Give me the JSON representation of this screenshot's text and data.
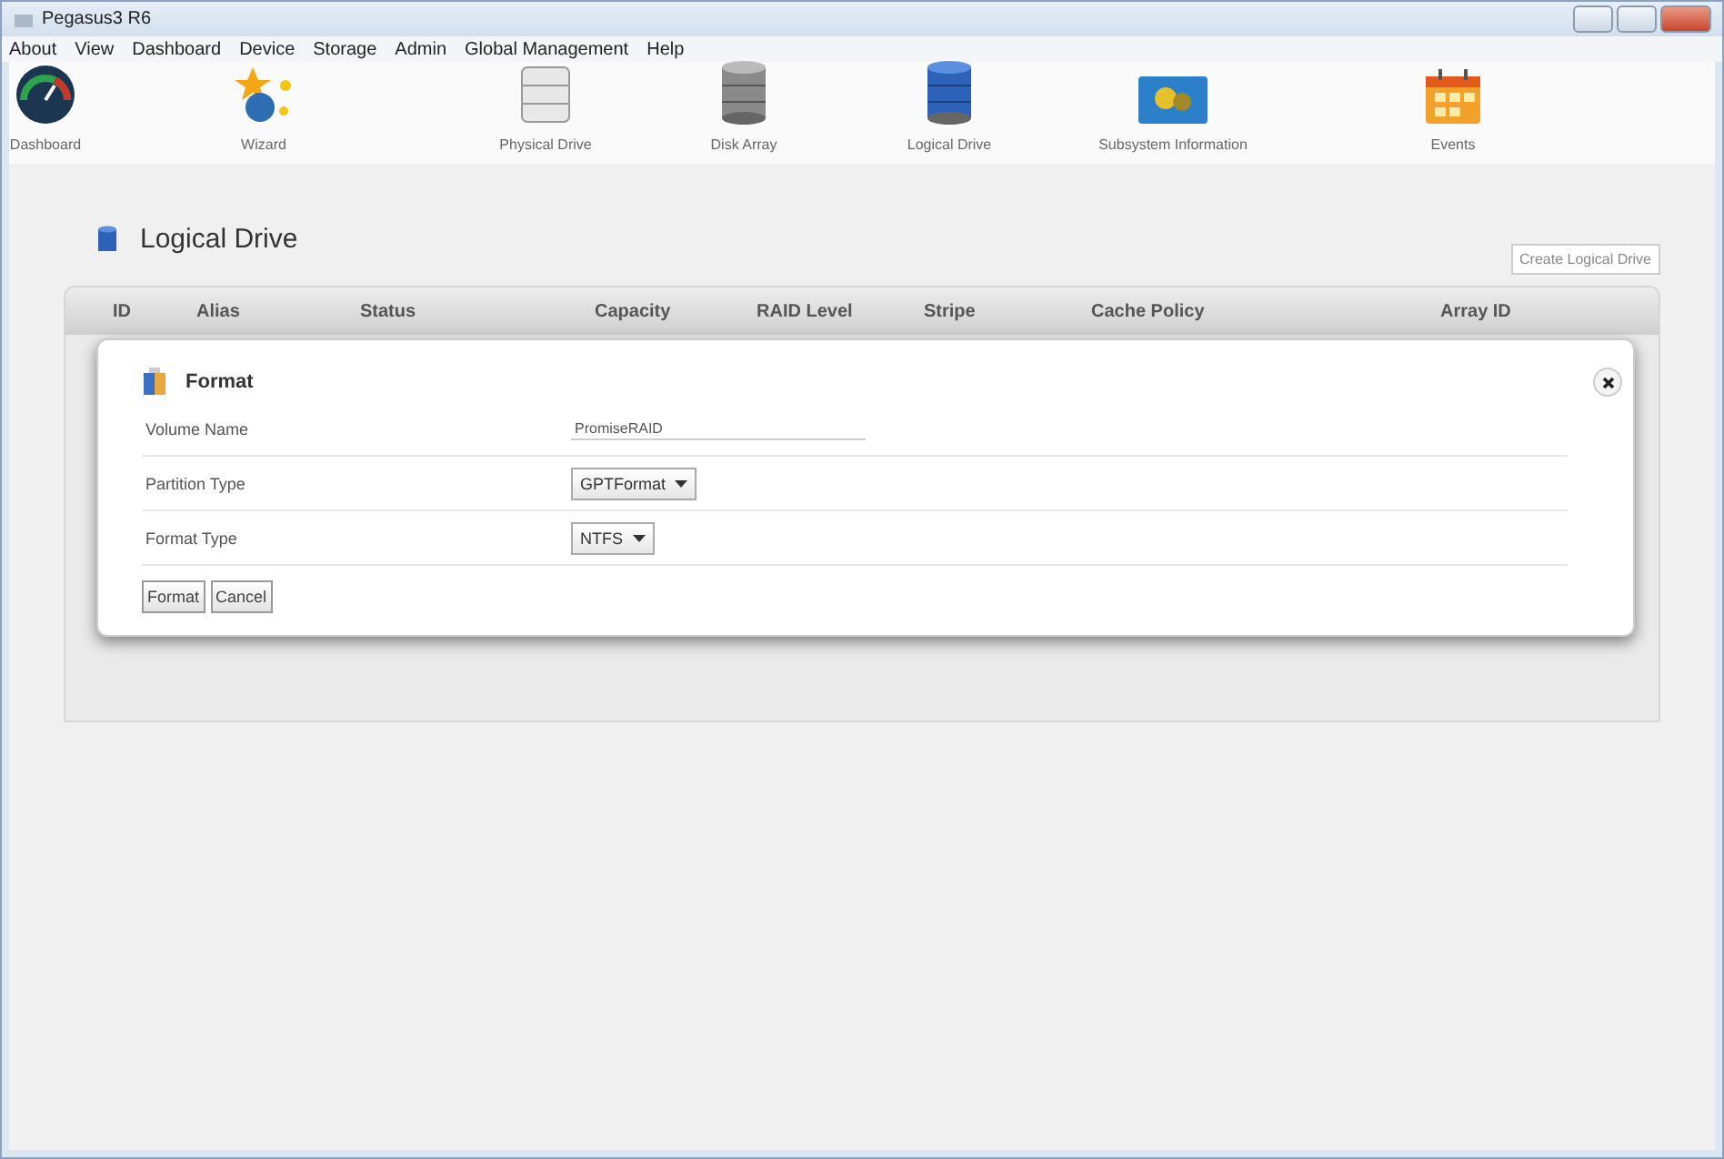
{
  "window": {
    "title": "Pegasus3 R6"
  },
  "menu": [
    "About",
    "View",
    "Dashboard",
    "Device",
    "Storage",
    "Admin",
    "Global Management",
    "Help"
  ],
  "toolbar": [
    {
      "label": "Dashboard",
      "kind": "gauge"
    },
    {
      "label": "Wizard",
      "kind": "wizard"
    },
    {
      "label": "Physical Drive",
      "kind": "drive"
    },
    {
      "label": "Disk Array",
      "kind": "array"
    },
    {
      "label": "Logical Drive",
      "kind": "logical"
    },
    {
      "label": "Subsystem Information",
      "kind": "subsystem"
    },
    {
      "label": "Events",
      "kind": "events"
    }
  ],
  "page": {
    "title": "Logical Drive",
    "create_button": "Create Logical Drive"
  },
  "table": {
    "columns": [
      "ID",
      "Alias",
      "Status",
      "Capacity",
      "RAID Level",
      "Stripe",
      "Cache Policy",
      "Array ID"
    ]
  },
  "dialog": {
    "title": "Format",
    "fields": [
      {
        "label": "Volume Name",
        "kind": "text",
        "value": "PromiseRAID"
      },
      {
        "label": "Partition Type",
        "kind": "select",
        "value": "GPTFormat"
      },
      {
        "label": "Format Type",
        "kind": "select",
        "value": "NTFS"
      }
    ],
    "buttons": [
      "Format",
      "Cancel"
    ]
  }
}
